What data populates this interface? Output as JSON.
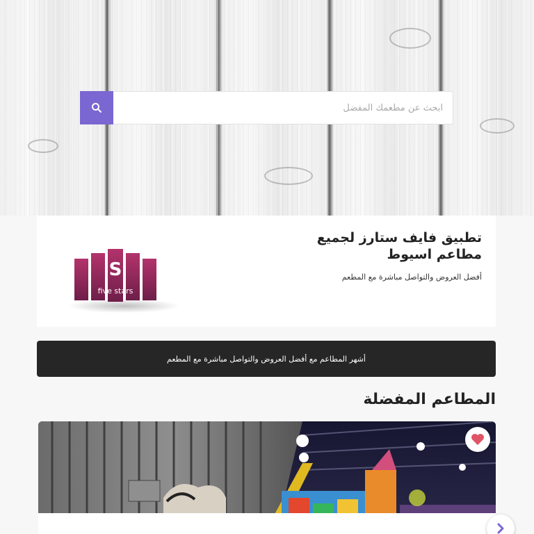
{
  "search": {
    "placeholder": "ابحث عن مطعمك المفضل",
    "button_icon": "search-icon"
  },
  "intro": {
    "title": "تطبيق فايف ستارز لجميع مطاعم اسيوط",
    "subtitle": "أفضل العروض والتواصل مباشرة مع المطعم",
    "logo_text": "five stars",
    "logo_letter": "S"
  },
  "banner": {
    "text": "أشهر المطاعم مع أفضل العروض والتواصل مباشرة مع المطعم"
  },
  "favorites": {
    "title": "المطاعم المفضلة",
    "fav_icon": "heart-icon",
    "next_icon": "chevron-right-icon"
  },
  "colors": {
    "accent": "#7b67d1",
    "banner_bg": "#262626",
    "heart": "#e05565"
  }
}
